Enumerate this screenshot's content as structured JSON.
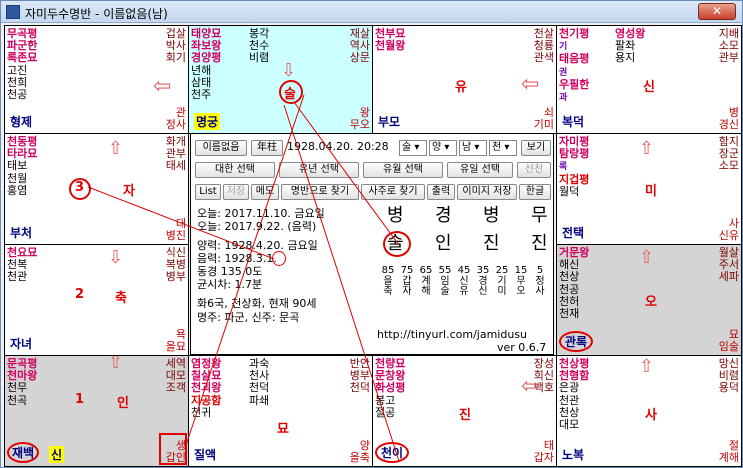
{
  "window": {
    "title": "자미두수명반 - 이름없음(남)",
    "close": "✕"
  },
  "palaces": {
    "p_si": {
      "stars": [
        "무곡평",
        "파군한",
        "록존묘",
        "고진",
        "천희",
        "천공"
      ],
      "mid": [],
      "right": [
        "겁살",
        "박사",
        "회기"
      ],
      "br": [
        "관",
        "정사"
      ],
      "name": "형제"
    },
    "p_o_top": {
      "stars": [
        "태양묘",
        "좌보왕",
        "경양평",
        "년해",
        "삼태",
        "천주"
      ],
      "mid": [
        "봉각",
        "천수",
        "비렴"
      ],
      "right": [
        "재살",
        "역사",
        "상문"
      ],
      "br": [
        "왕",
        "무오"
      ],
      "name": "명궁"
    },
    "p_mi_top": {
      "stars": [
        "천부묘",
        "천월왕"
      ],
      "mid": [],
      "right": [
        "천살",
        "청룡",
        "관색"
      ],
      "br": [
        "쇠",
        "기미"
      ],
      "name": "부모",
      "big": "유"
    },
    "p_sin_top": {
      "stars": [
        "천기평",
        "기",
        "태음평",
        "권",
        "우필한",
        "과"
      ],
      "mid": [
        "영성왕",
        "팔좌",
        "용지"
      ],
      "right": [
        "지배",
        "소모",
        "관부"
      ],
      "br": [
        "병",
        "경신"
      ],
      "name": "복덕",
      "big": "신"
    },
    "p_jin_left": {
      "stars": [
        "천동평",
        "타라묘",
        "태보",
        "천월",
        "홍염"
      ],
      "mid": [],
      "right": [
        "화개",
        "관부",
        "태세"
      ],
      "br": [
        "대",
        "병진"
      ],
      "name": "부처",
      "big": "자",
      "num": "3"
    },
    "p_yu_right": {
      "stars": [
        "자미평",
        "탐랑평",
        "록",
        "지겁평",
        "월덕"
      ],
      "mid": [],
      "right": [
        "함지",
        "장군",
        "소모"
      ],
      "br": [
        "사",
        "신유"
      ],
      "name": "전택",
      "big": "미"
    },
    "p_myo": {
      "stars": [
        "천요묘",
        "천복",
        "천관"
      ],
      "mid": [],
      "right": [
        "식신",
        "복병",
        "병부"
      ],
      "br": [
        "욕",
        "을묘"
      ],
      "name": "자녀",
      "big": "축",
      "num": "2"
    },
    "p_sul": {
      "stars": [
        "거문왕",
        "해신",
        "천상",
        "천공",
        "천허",
        "천재"
      ],
      "mid": [],
      "right": [
        "월살",
        "주서",
        "세파"
      ],
      "br": [
        "묘",
        "임술"
      ],
      "name": "관록",
      "big": "오"
    },
    "p_in": {
      "stars": [
        "문곡평",
        "천마왕",
        "천무",
        "천곡"
      ],
      "mid": [],
      "right": [
        "세역",
        "대모",
        "조객"
      ],
      "br": [
        "생",
        "갑인"
      ],
      "name": "재백",
      "name2": "신",
      "big": "인",
      "num": "1"
    },
    "p_chuk": {
      "stars": [
        "염정왕",
        "칠살묘",
        "천괴왕",
        "지공함",
        "천귀"
      ],
      "mid": [
        "과숙",
        "천사",
        "천덕",
        "파쇄"
      ],
      "right": [
        "반안",
        "병부",
        "천덕"
      ],
      "br": [
        "양",
        "을축"
      ],
      "name": "질액",
      "big": "묘"
    },
    "p_ja": {
      "stars": [
        "천량묘",
        "문창왕",
        "화성평",
        "봉고",
        "절공"
      ],
      "mid": [],
      "right": [
        "장성",
        "희신",
        "백호"
      ],
      "br": [
        "태",
        "갑자"
      ],
      "name": "천이",
      "big": "진"
    },
    "p_hae": {
      "stars": [
        "천상평",
        "천형함",
        "은광",
        "천관",
        "천상",
        "대모"
      ],
      "mid": [],
      "right": [
        "망신",
        "비렴",
        "용덕"
      ],
      "br": [
        "절",
        "계해"
      ],
      "name": "노복",
      "big": "사"
    }
  },
  "top_circle": "술",
  "center": {
    "name_btn": "이름없음",
    "year_btn": "年柱",
    "date_text": "1928.04.20. 20:28",
    "sel_time": "술",
    "sel_yy": "양",
    "sel_gender": "남",
    "sel_cheon": "천",
    "view_btn": "보기",
    "row2": [
      "대한 선택",
      "유년 선택",
      "유월 선택",
      "유일 선택",
      "선천"
    ],
    "row3": [
      "List",
      "저장",
      "메모",
      "명반으로 찾기",
      "사주로 찾기",
      "출력",
      "이미지 저장",
      "한글"
    ],
    "today": "오늘: 2017.11.10. 금요일",
    "today2": "오늘: 2017.9.22. (음력)",
    "solar": "양력: 1928.4.20. 금요일",
    "lunar": "음력: 1928.3.1.",
    "tz": "동경 135.0도",
    "time_diff": "균시차: 1.7분",
    "guk": "화6국, 천상화, 현재 90세",
    "myeongju": "명주: 파군, 신주: 문곡",
    "url": "http://tinyurl.com/jamidusu",
    "ver": "ver 0.6.7",
    "ganji_top": [
      "병",
      "경",
      "병",
      "무"
    ],
    "ganji_bottom": [
      "술",
      "인",
      "진",
      "진"
    ],
    "age_cols": [
      [
        "85",
        "을",
        "축"
      ],
      [
        "75",
        "갑",
        "자"
      ],
      [
        "65",
        "계",
        "해"
      ],
      [
        "55",
        "임",
        "술"
      ],
      [
        "45",
        "신",
        "유"
      ],
      [
        "35",
        "경",
        "신"
      ],
      [
        "25",
        "기",
        "미"
      ],
      [
        "15",
        "무",
        "오"
      ],
      [
        "5",
        "정",
        "사"
      ]
    ]
  }
}
